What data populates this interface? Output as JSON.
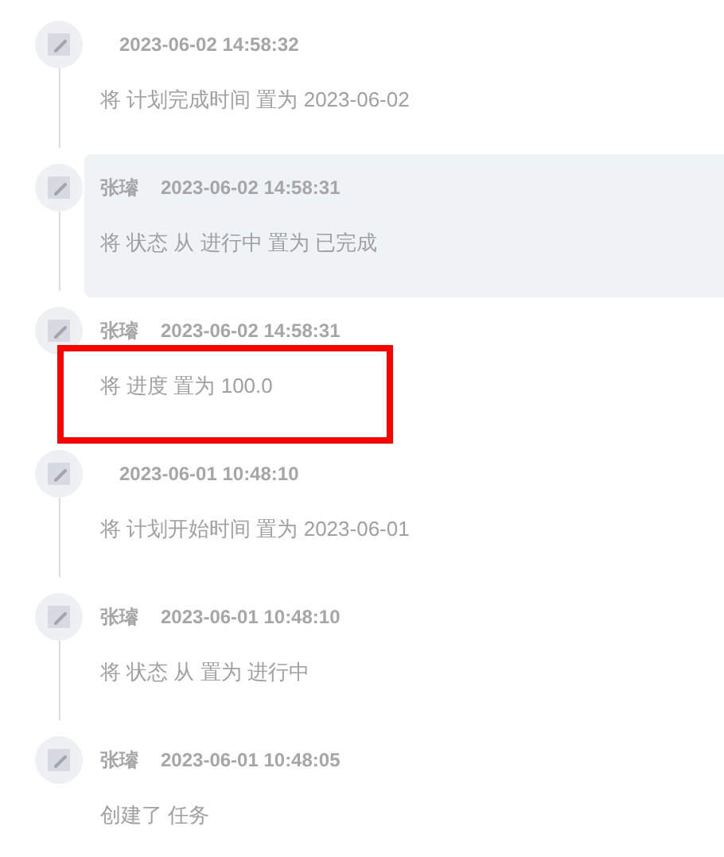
{
  "activities": [
    {
      "time": "2023-06-02 14:58:32",
      "text": "将 计划完成时间 置为 2023-06-02",
      "hovered": false,
      "marked": false
    },
    {
      "user": "张璿",
      "time": "2023-06-02 14:58:31",
      "text": "将 状态 从 进行中 置为 已完成",
      "hovered": true,
      "marked": false
    },
    {
      "user": "张璿",
      "time": "2023-06-02 14:58:31",
      "text": "将 进度 置为 100.0",
      "hovered": false,
      "marked": true
    },
    {
      "time": "2023-06-01 10:48:10",
      "text": "将 计划开始时间 置为 2023-06-01",
      "hovered": false,
      "marked": false
    },
    {
      "user": "张璿",
      "time": "2023-06-01 10:48:10",
      "text": "将 状态 从 置为 进行中",
      "hovered": false,
      "marked": false
    },
    {
      "user": "张璿",
      "time": "2023-06-01 10:48:05",
      "text": "创建了 任务",
      "hovered": false,
      "marked": false
    }
  ]
}
